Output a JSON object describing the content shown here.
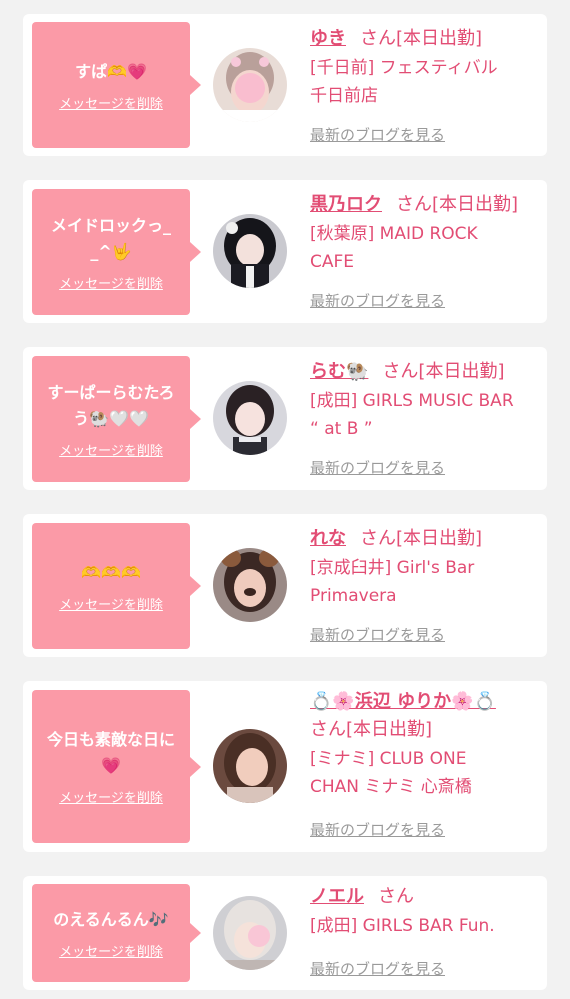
{
  "delete_label": "メッセージを削除",
  "blog_label": "最新のブログを見る",
  "san_label": "さん",
  "cards": [
    {
      "message_lines": [
        "すぱ🫶💗"
      ],
      "name": "ゆき",
      "status": "[本日出勤]",
      "shop_lines": [
        "[千日前] フェスティバル",
        "千日前店"
      ]
    },
    {
      "message_lines": [
        "メイドロックっ_",
        "_^🤟"
      ],
      "name": "黒乃ロク",
      "status": "[本日出勤]",
      "shop_lines": [
        "[秋葉原] MAID ROCK",
        "CAFE"
      ]
    },
    {
      "message_lines": [
        "すーぱーらむたろ",
        "う🐏🤍🤍"
      ],
      "name": "らむ🐏",
      "status": "[本日出勤]",
      "shop_lines": [
        "[成田] GIRLS MUSIC BAR",
        "“ at B ”"
      ]
    },
    {
      "message_lines": [
        "🫶🫶🫶"
      ],
      "name": "れな",
      "status": "[本日出勤]",
      "shop_lines": [
        "[京成臼井] Girl's Bar",
        "Primavera"
      ]
    },
    {
      "message_lines": [
        "今日も素敵な日に",
        "💗"
      ],
      "name": "💍🌸浜辺 ゆりか🌸💍",
      "status": "[本日出勤]",
      "shop_lines": [
        "[ミナミ] CLUB ONE",
        "CHAN ミナミ 心斎橋"
      ]
    },
    {
      "message_lines": [
        "のえるんるん🎶"
      ],
      "name": "ノエル",
      "status": "",
      "shop_lines": [
        "[成田] GIRLS BAR Fun."
      ]
    }
  ]
}
